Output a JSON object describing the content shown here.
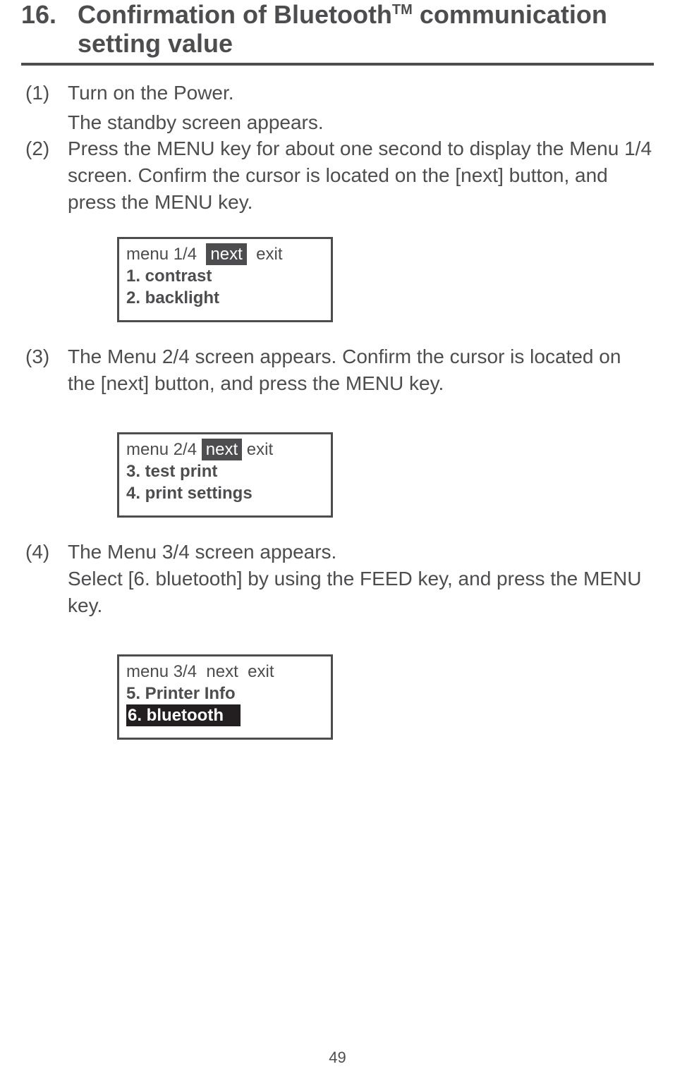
{
  "header": {
    "number": "16.",
    "title_line1": "Confirmation of Bluetooth",
    "tm": "TM",
    "title_line1b": " communication",
    "title_line2": "setting value"
  },
  "steps": {
    "s1_num": "(1)",
    "s1_l1": "Turn on the Power.",
    "s1_l2": "The standby screen appears.",
    "s2_num": "(2)",
    "s2_l1": "Press the MENU key for about one second to display the Menu 1/4 screen.  Confirm the cursor is located on the [next] button, and press the MENU key.",
    "s3_num": "(3)",
    "s3_l1": "The Menu 2/4 screen appears.  Confirm the cursor is located on the [next] button, and press the MENU key.",
    "s4_num": "(4)",
    "s4_l1": "The Menu 3/4 screen appears.",
    "s4_l2": "Select [6. bluetooth] by using the FEED key, and press the MENU key."
  },
  "lcd1": {
    "menu": "menu 1/4",
    "next": "next",
    "exit": "exit",
    "item1": "1. contrast",
    "item2": "2. backlight"
  },
  "lcd2": {
    "menu": "menu 2/4",
    "next": "next",
    "exit": "exit",
    "item1": "3. test print",
    "item2": "4. print settings"
  },
  "lcd3": {
    "menu": "menu  3/4",
    "next": "next",
    "exit": "exit",
    "item1": "5. Printer Info",
    "item2": "6. bluetooth"
  },
  "page_number": "49"
}
